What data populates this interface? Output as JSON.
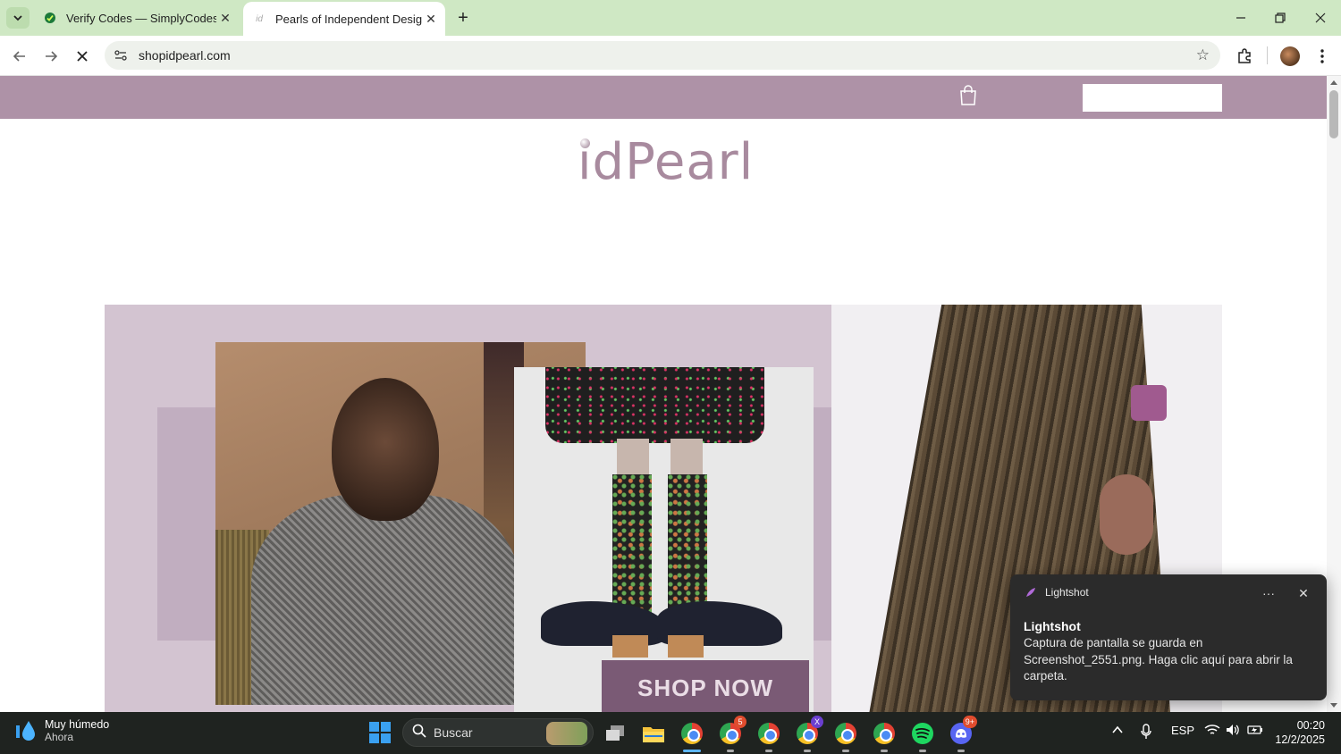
{
  "browser": {
    "tabs": [
      {
        "title": "Verify Codes — SimplyCodes",
        "active": false,
        "favicon": "simplycodes-icon"
      },
      {
        "title": "Pearls of Independent Designers",
        "active": true,
        "favicon": "idpearl-icon"
      }
    ],
    "url": "shopidpearl.com",
    "tab_strip_color": "#cfe8c4"
  },
  "site": {
    "header_color": "#ae92a7",
    "logo_text": "idPearl",
    "search_placeholder": "",
    "hero": {
      "cta_label": "SHOP NOW",
      "background_color": "#d3c4d1"
    }
  },
  "notification": {
    "app_name": "Lightshot",
    "title": "Lightshot",
    "body": "Captura de pantalla se guarda en Screenshot_2551.png. Haga clic aquí para abrir la carpeta."
  },
  "taskbar": {
    "weather_main": "Muy húmedo",
    "weather_sub": "Ahora",
    "search_placeholder": "Buscar",
    "language": "ESP",
    "time": "00:20",
    "date": "12/2/2025",
    "badges": {
      "chrome2": "5",
      "chrome4": "X",
      "discord": "9+"
    }
  }
}
